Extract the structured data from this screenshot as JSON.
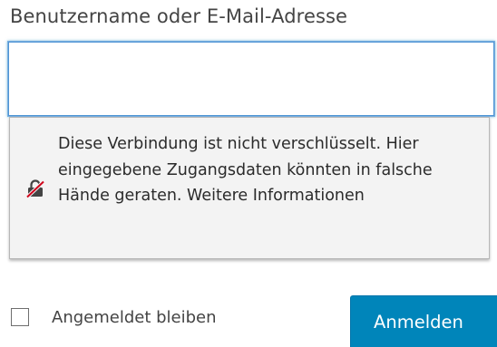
{
  "form": {
    "username_label": "Benutzername oder E-Mail-Adresse",
    "username_value": "",
    "username_placeholder": "",
    "remember_label": "Angemeldet bleiben",
    "remember_checked": false,
    "login_button_label": "Anmelden"
  },
  "insecure_warning": {
    "icon": "insecure-lock-icon",
    "text": "Diese Verbindung ist nicht verschlüsselt. Hier eingegebene Zugangsdaten könnten in falsche Hände geraten. Weitere Informationen"
  },
  "colors": {
    "button": "#0085ba",
    "focus_border": "#4f94d4",
    "warning_background": "#f3f3f3",
    "insecure_strike": "#d0021b"
  }
}
